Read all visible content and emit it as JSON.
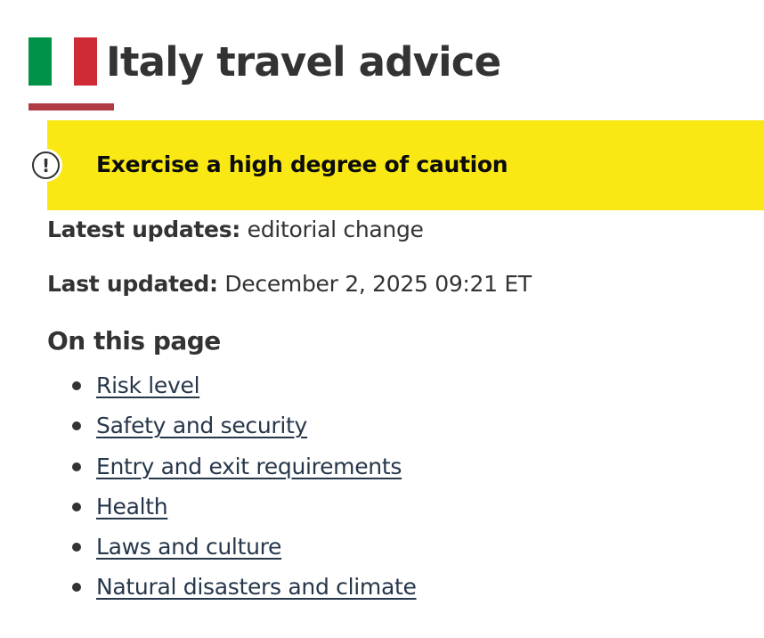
{
  "header": {
    "title": "Italy travel advice",
    "flag": {
      "icon": "italy-flag-icon",
      "colors": [
        "#009246",
        "#ffffff",
        "#ce2b37"
      ]
    },
    "underline_color": "#af3c43"
  },
  "alert": {
    "icon": "exclamation-icon",
    "text": "Exercise a high degree of caution",
    "background": "#f9e814"
  },
  "meta": {
    "latest_updates_label": "Latest updates:",
    "latest_updates_value": "editorial change",
    "last_updated_label": "Last updated:",
    "last_updated_value": "December 2, 2025 09:21 ET"
  },
  "toc": {
    "heading": "On this page",
    "links": [
      "Risk level",
      "Safety and security",
      "Entry and exit requirements",
      "Health",
      "Laws and culture",
      "Natural disasters and climate"
    ],
    "link_color": "#26374a"
  }
}
